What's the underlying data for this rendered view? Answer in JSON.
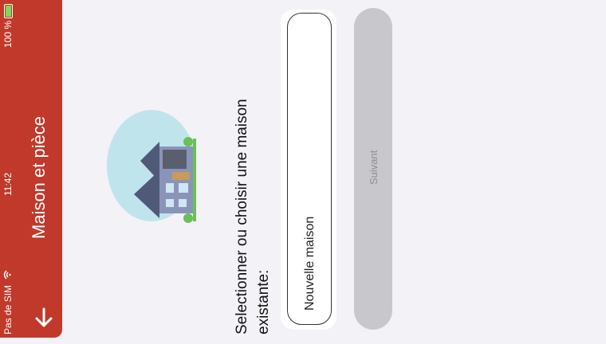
{
  "status_bar": {
    "carrier": "Pas de SIM",
    "time": "11:42",
    "battery": "100 %"
  },
  "header": {
    "title": "Maison et pièce",
    "back_icon": "arrow-down-icon",
    "color": "#c0392b"
  },
  "content": {
    "prompt": "Selectionner ou choisir une maison existante:",
    "illustration": "house-illustration",
    "new_house_label": "Nouvelle maison",
    "next_label": "Suivant"
  }
}
